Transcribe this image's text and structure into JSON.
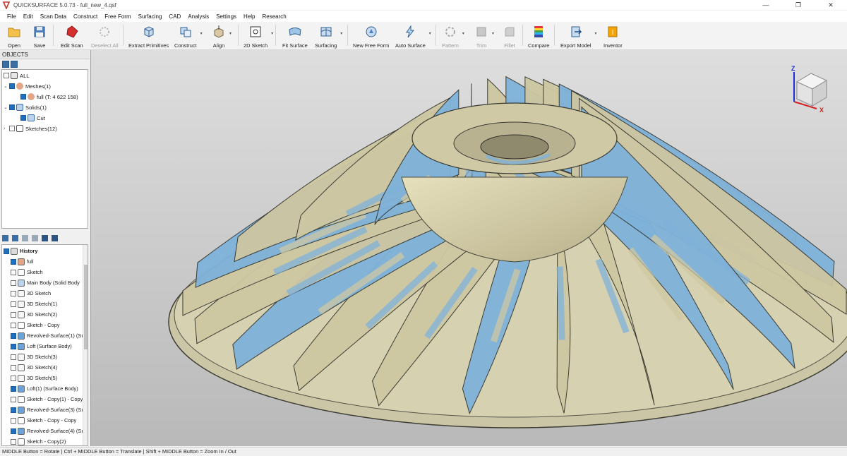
{
  "window": {
    "title": "QUICKSURFACE 5.0.73 - full_new_4.qsf",
    "minimize": "—",
    "maximize": "❐",
    "close": "✕"
  },
  "menu": [
    "File",
    "Edit",
    "Scan Data",
    "Construct",
    "Free Form",
    "Surfacing",
    "CAD",
    "Analysis",
    "Settings",
    "Help",
    "Research"
  ],
  "toolbar": {
    "open": "Open",
    "save": "Save",
    "edit_scan": "Edit Scan",
    "deselect_all": "Deselect All",
    "extract_primitives": "Extract Primitives",
    "construct": "Construct",
    "align": "Align",
    "sketch_2d": "2D Sketch",
    "fit_surface": "Fit Surface",
    "surfacing": "Surfacing",
    "new_free_form": "New Free Form",
    "auto_surface": "Auto Surface",
    "pattern": "Pattern",
    "trim": "Trim",
    "fillet": "Fillet",
    "compare": "Compare",
    "export_model": "Export Model",
    "inventor": "Inventor"
  },
  "objects_panel": {
    "title": "OBJECTS",
    "tree": [
      {
        "label": "ALL",
        "checked": false
      },
      {
        "label": "Meshes(1)",
        "checked": true
      },
      {
        "label": "full (T: 4 622 158)",
        "checked": true
      },
      {
        "label": "Solids(1)",
        "checked": true
      },
      {
        "label": "Cut",
        "checked": true
      },
      {
        "label": "Sketches(12)",
        "checked": false
      }
    ]
  },
  "history_panel": {
    "items": [
      {
        "label": "History",
        "checked": true
      },
      {
        "label": "full",
        "checked": true
      },
      {
        "label": "Sketch",
        "checked": false
      },
      {
        "label": "Main Body (Solid Body",
        "checked": false
      },
      {
        "label": "3D Sketch",
        "checked": false
      },
      {
        "label": "3D Sketch(1)",
        "checked": false
      },
      {
        "label": "3D Sketch(2)",
        "checked": false
      },
      {
        "label": "Sketch - Copy",
        "checked": false
      },
      {
        "label": "Revolved-Surface(1) (Sı",
        "checked": true
      },
      {
        "label": "Loft (Surface Body)",
        "checked": true
      },
      {
        "label": "3D Sketch(3)",
        "checked": false
      },
      {
        "label": "3D Sketch(4)",
        "checked": false
      },
      {
        "label": "3D Sketch(5)",
        "checked": false
      },
      {
        "label": "Loft(1) (Surface Body)",
        "checked": true
      },
      {
        "label": "Sketch - Copy(1) - Copy",
        "checked": false
      },
      {
        "label": "Revolved-Surface(3) (Sı",
        "checked": true
      },
      {
        "label": "Sketch - Copy - Copy",
        "checked": false
      },
      {
        "label": "Revolved-Surface(4) (Sı",
        "checked": true
      },
      {
        "label": "Sketch - Copy(2)",
        "checked": false
      }
    ]
  },
  "view_cube": {
    "z_label": "Z",
    "x_label": "X"
  },
  "status": "MIDDLE Button = Rotate | Ctrl + MIDDLE Button = Translate | Shift + MIDDLE Button = Zoom In / Out",
  "colors": {
    "mesh_surface": "#cdc7a2",
    "deviation_blue": "#7fb2da",
    "selection": "#1f6fbf"
  }
}
